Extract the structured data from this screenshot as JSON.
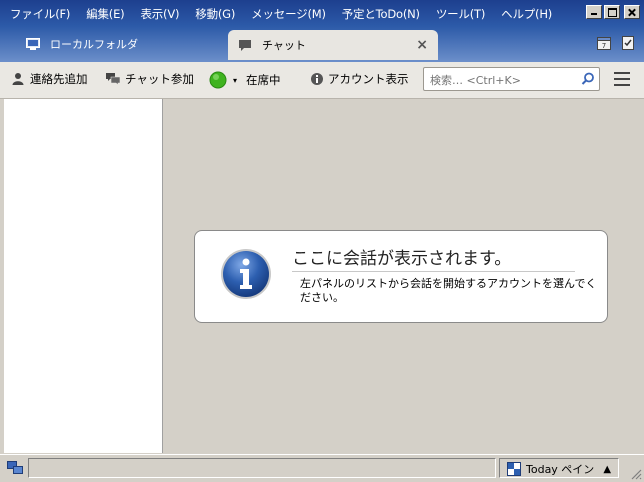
{
  "menu": [
    "ファイル(F)",
    "編集(E)",
    "表示(V)",
    "移動(G)",
    "メッセージ(M)",
    "予定とToDo(N)",
    "ツール(T)",
    "ヘルプ(H)"
  ],
  "tabs": {
    "folder": "ローカルフォルダ",
    "chat": "チャット",
    "close": "×"
  },
  "toolbar": {
    "add_contact": "連絡先追加",
    "join_chat": "チャット参加",
    "status": "在席中",
    "account_display": "アカウント表示",
    "search_placeholder": "検索… <Ctrl+K>"
  },
  "notification": {
    "title": "ここに会話が表示されます。",
    "description": "左パネルのリストから会話を開始するアカウントを選んでください。"
  },
  "statusbar": {
    "today_pane": "Today ペイン"
  },
  "colors": {
    "status_online": "#3fb31f",
    "info_blue": "#2d5fb0",
    "titlebar": "#1d3f8e"
  },
  "icons": [
    "monitor-icon",
    "chat-bubble-icon",
    "person-add-icon",
    "chat-join-icon",
    "status-dot-icon",
    "info-icon",
    "search-icon",
    "menu-icon",
    "calendar-icon",
    "tasks-icon",
    "today-icon",
    "network-icon"
  ]
}
